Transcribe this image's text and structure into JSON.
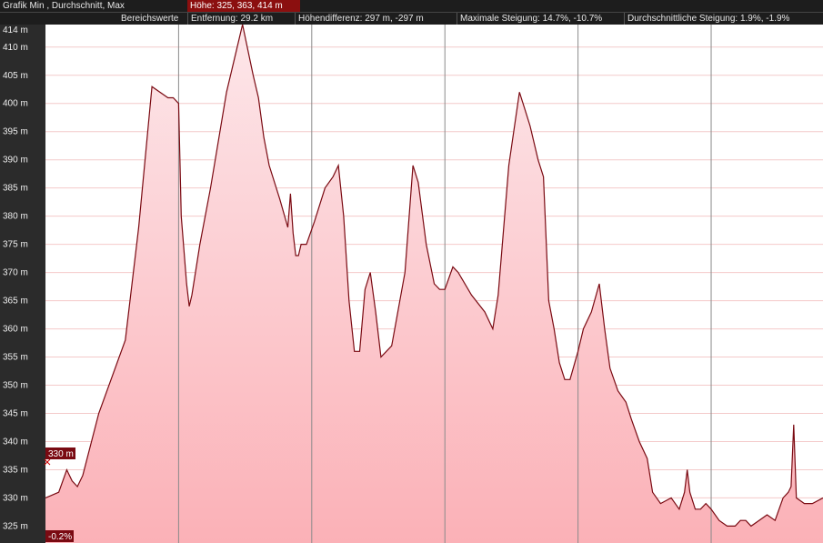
{
  "header": {
    "graph_label": "Grafik  Min , Durchschnitt, Max",
    "hoehe_label": "Höhe: 325, 363, 414 m",
    "range_label": "Bereichswerte",
    "distance_label": "Entfernung: 29.2 km",
    "diff_label": "Höhendifferenz: 297 m, -297 m",
    "maxslope_label": "Maximale Steigung: 14.7%, -10.7%",
    "avgslope_label": "Durchschnittliche Steigung: 1.9%, -1.9%"
  },
  "cursor": {
    "value_label": "330 m",
    "slope_label": "-0.2%"
  },
  "colors": {
    "line": "#7a0a12",
    "fill_top": "#fde7ea",
    "fill_bottom": "#fbb1b7",
    "label_bg": "#7a0a12"
  },
  "chart_data": {
    "type": "area",
    "title": "",
    "xlabel": "",
    "ylabel": "",
    "ylim": [
      322,
      414
    ],
    "xlim": [
      0,
      29.2
    ],
    "y_ticks": [
      "414 m",
      "410 m",
      "405 m",
      "400 m",
      "395 m",
      "390 m",
      "385 m",
      "380 m",
      "375 m",
      "370 m",
      "365 m",
      "360 m",
      "355 m",
      "350 m",
      "345 m",
      "340 m",
      "335 m",
      "330 m",
      "325 m"
    ],
    "x_gridlines_km": [
      5,
      10,
      15,
      20,
      25
    ],
    "grid": true,
    "series": [
      {
        "x": [
          0,
          0.5,
          0.8,
          1.0,
          1.2,
          1.4,
          2.0,
          3.0,
          3.5,
          4.0,
          4.6,
          4.8,
          5.0,
          5.1,
          5.3,
          5.4,
          5.5,
          5.8,
          6.2,
          6.8,
          7.1,
          7.4,
          7.8,
          8.0,
          8.2,
          8.4,
          8.8,
          9.1,
          9.2,
          9.3,
          9.4,
          9.5,
          9.6,
          9.8,
          10.1,
          10.5,
          10.8,
          11.0,
          11.2,
          11.4,
          11.6,
          11.8,
          12.0,
          12.2,
          12.4,
          12.6,
          13.0,
          13.5,
          13.8,
          14.0,
          14.3,
          14.6,
          14.8,
          15.0,
          15.3,
          15.5,
          16.0,
          16.5,
          16.8,
          17.0,
          17.4,
          17.8,
          18.0,
          18.2,
          18.5,
          18.7,
          18.9,
          19.1,
          19.3,
          19.5,
          19.7,
          20.0,
          20.2,
          20.5,
          20.8,
          21.0,
          21.2,
          21.5,
          21.8,
          22.0,
          22.3,
          22.6,
          22.8,
          23.1,
          23.5,
          23.8,
          24.0,
          24.1,
          24.2,
          24.4,
          24.6,
          24.8,
          25.0,
          25.3,
          25.6,
          25.9,
          26.1,
          26.3,
          26.5,
          26.8,
          27.1,
          27.4,
          27.7,
          27.9,
          28.0,
          28.1,
          28.2,
          28.5,
          28.8,
          29.2
        ],
        "y": [
          330,
          331,
          335,
          333,
          332,
          334,
          345,
          358,
          378,
          403,
          401,
          401,
          400,
          380,
          368,
          364,
          366,
          375,
          385,
          402,
          408,
          414,
          405,
          401,
          394,
          389,
          383,
          378,
          384,
          377,
          373,
          373,
          375,
          375,
          379,
          385,
          387,
          389,
          380,
          365,
          356,
          356,
          367,
          370,
          363,
          355,
          357,
          370,
          389,
          386,
          375,
          368,
          367,
          367,
          371,
          370,
          366,
          363,
          360,
          366,
          389,
          402,
          399,
          396,
          390,
          387,
          365,
          360,
          354,
          351,
          351,
          356,
          360,
          363,
          368,
          360,
          353,
          349,
          347,
          344,
          340,
          337,
          331,
          329,
          330,
          328,
          331,
          335,
          331,
          328,
          328,
          329,
          328,
          326,
          325,
          325,
          326,
          326,
          325,
          326,
          327,
          326,
          330,
          331,
          332,
          343,
          330,
          329,
          329,
          330
        ]
      }
    ]
  }
}
